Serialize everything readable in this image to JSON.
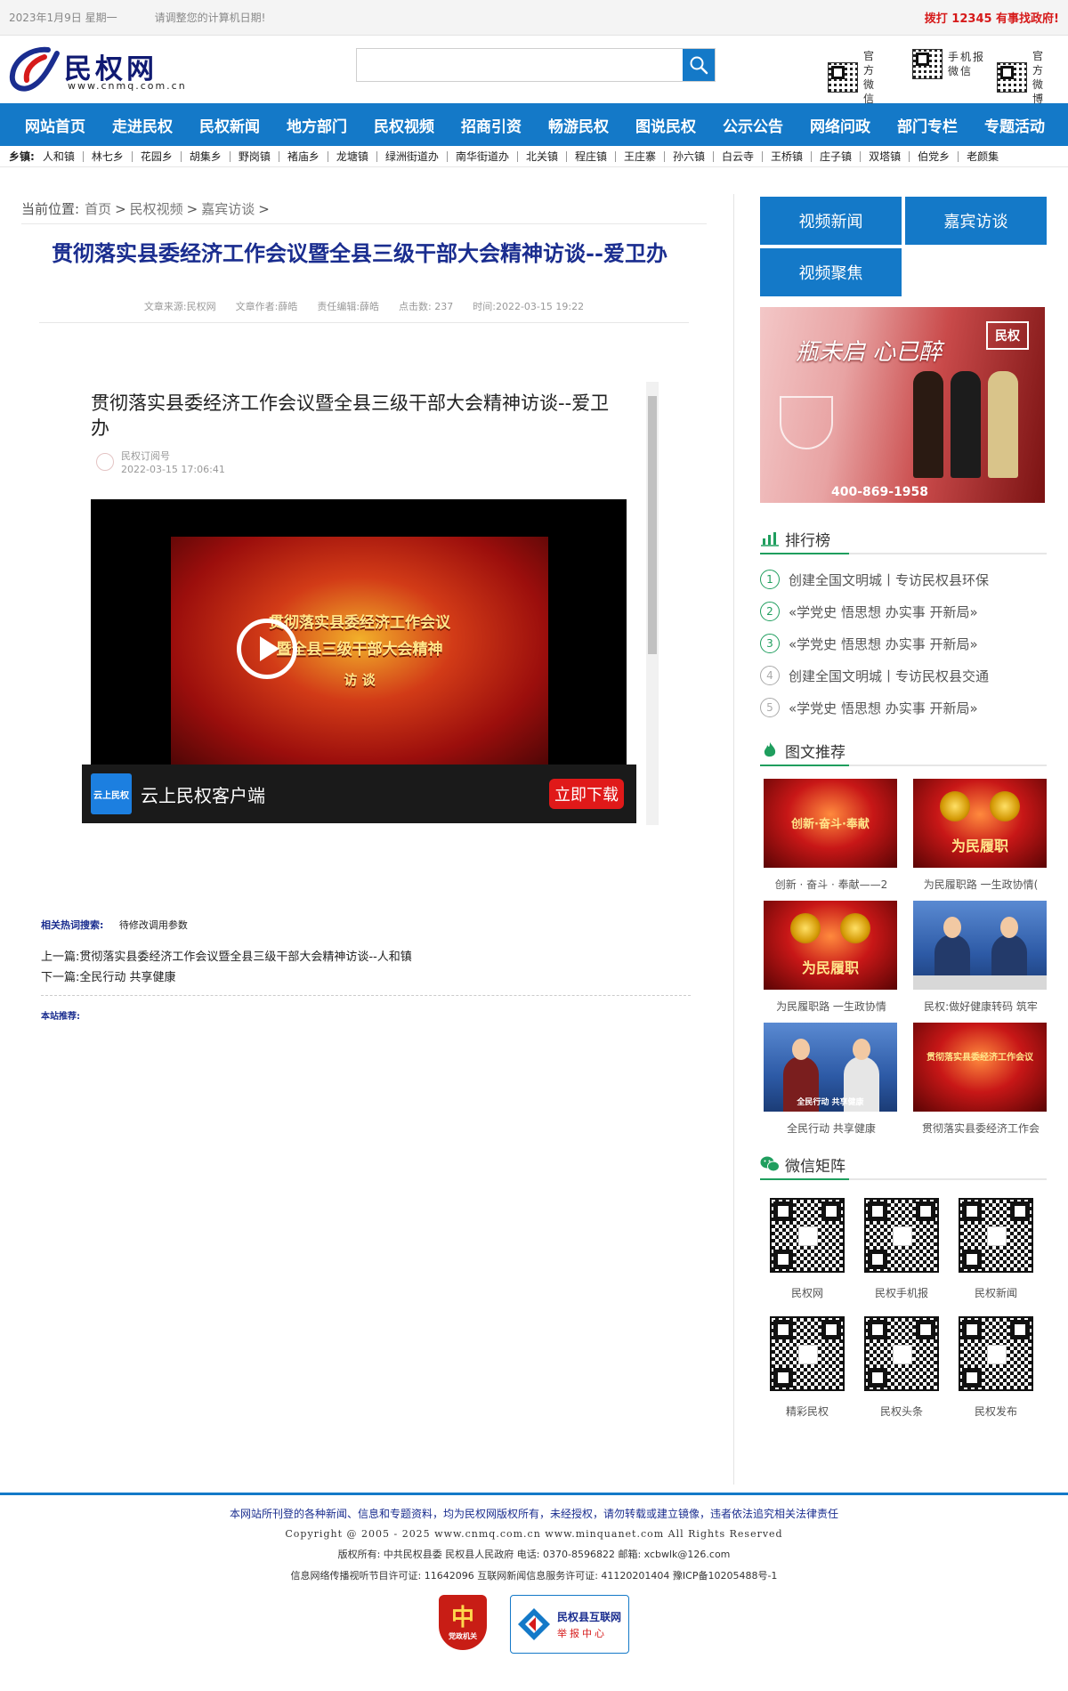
{
  "topbar": {
    "date": "2023年1月9日 星期一",
    "tip": "请调整您的计算机日期!",
    "hotline": "拨打 12345 有事找政府!"
  },
  "header": {
    "logo_text": "民权网",
    "logo_url": "www.cnmq.com.cn",
    "search_placeholder": "",
    "qr_labels": [
      "官方微信",
      "手机报微信",
      "官方微博"
    ]
  },
  "nav": {
    "items": [
      "网站首页",
      "走进民权",
      "民权新闻",
      "地方部门",
      "民权视频",
      "招商引资",
      "畅游民权",
      "图说民权",
      "公示公告",
      "网络问政",
      "部门专栏",
      "专题活动"
    ]
  },
  "towns": {
    "label": "乡镇:",
    "items": [
      "人和镇",
      "林七乡",
      "花园乡",
      "胡集乡",
      "野岗镇",
      "褚庙乡",
      "龙塘镇",
      "绿洲街道办",
      "南华街道办",
      "北关镇",
      "程庄镇",
      "王庄寨",
      "孙六镇",
      "白云寺",
      "王桥镇",
      "庄子镇",
      "双塔镇",
      "伯党乡",
      "老颜集"
    ]
  },
  "breadcrumb": {
    "label": "当前位置:",
    "home": "首页",
    "level1": "民权视频",
    "level2": "嘉宾访谈",
    "sep": ">"
  },
  "article": {
    "title": "贯彻落实县委经济工作会议暨全县三级干部大会精神访谈--爱卫办",
    "meta": {
      "source": "文章来源:民权网",
      "author": "文章作者:薛皓",
      "editor": "责任编辑:薛皓",
      "clicks": "点击数: 237",
      "time": "时间:2022-03-15 19:22"
    },
    "embed": {
      "title": "贯彻落实县委经济工作会议暨全县三级干部大会精神访谈--爱卫办",
      "source_name": "民权订阅号",
      "source_time": "2022-03-15 17:06:41",
      "video_line1": "贯彻落实县委经济工作会议",
      "video_line2": "暨全县三级干部大会精神",
      "video_line3": "访 谈",
      "app_icon_text": "云上民权",
      "app_name": "云上民权客户端",
      "download": "立即下载"
    },
    "related_label": "相关热词搜索:",
    "related_value": "待修改调用参数",
    "prev": "上一篇:贯彻落实县委经济工作会议暨全县三级干部大会精神访谈--人和镇",
    "next": "下一篇:全民行动 共享健康",
    "recommend": "本站推荐:"
  },
  "sidebar": {
    "tabs": [
      "视频新闻",
      "嘉宾访谈",
      "视频聚焦"
    ],
    "ad": {
      "slogan": "瓶未启 心已醉",
      "brand": "民权",
      "phone": "400-869-1958"
    },
    "ranking_title": "排行榜",
    "ranking": [
      {
        "num": "1",
        "text": "创建全国文明城丨专访民权县环保"
      },
      {
        "num": "2",
        "text": "«学党史 悟思想 办实事 开新局»"
      },
      {
        "num": "3",
        "text": "«学党史 悟思想 办实事 开新局»"
      },
      {
        "num": "4",
        "text": "创建全国文明城丨专访民权县交通"
      },
      {
        "num": "5",
        "text": "«学党史 悟思想 办实事 开新局»"
      }
    ],
    "pics_title": "图文推荐",
    "pics": [
      {
        "caption": "创新 · 奋斗 · 奉献——2",
        "thumb_text": "创新·奋斗·奉献"
      },
      {
        "caption": "为民履职路 一生政协情(",
        "thumb_text": "为民履职"
      },
      {
        "caption": "为民履职路 一生政协情",
        "thumb_text": "为民履职"
      },
      {
        "caption": "民权:做好健康转码 筑牢",
        "thumb_text": ""
      },
      {
        "caption": "全民行动 共享健康",
        "thumb_text": "全民行动 共享健康"
      },
      {
        "caption": "贯彻落实县委经济工作会",
        "thumb_text": "贯彻落实县委经济工作会议"
      }
    ],
    "wechat_title": "微信矩阵",
    "wechat": [
      "民权网",
      "民权手机报",
      "民权新闻",
      "精彩民权",
      "民权头条",
      "民权发布"
    ]
  },
  "footer": {
    "notice": "本网站所刊登的各种新闻、信息和专题资料，均为民权网版权所有，未经授权，请勿转载或建立镜像，违者依法追究相关法律责任",
    "copyright": "Copyright @ 2005 - 2025 www.cnmq.com.cn www.minquanet.com All Rights Reserved",
    "owner": "版权所有: 中共民权县委 民权县人民政府 电话: 0370-8596822 邮箱: xcbwlk@126.com",
    "license": "信息网络传播视听节目许可证: 11642096 互联网新闻信息服务许可证: 41120201404 豫ICP备10205488号-1",
    "badge_party": "党政机关",
    "report_name": "民权县互联网",
    "report_sub": "举报中心"
  },
  "colors": {
    "brand_blue": "#1479c8",
    "title_blue": "#1a2d8f",
    "accent_green": "#1f9e5e",
    "alert_red": "#d61a1a"
  }
}
